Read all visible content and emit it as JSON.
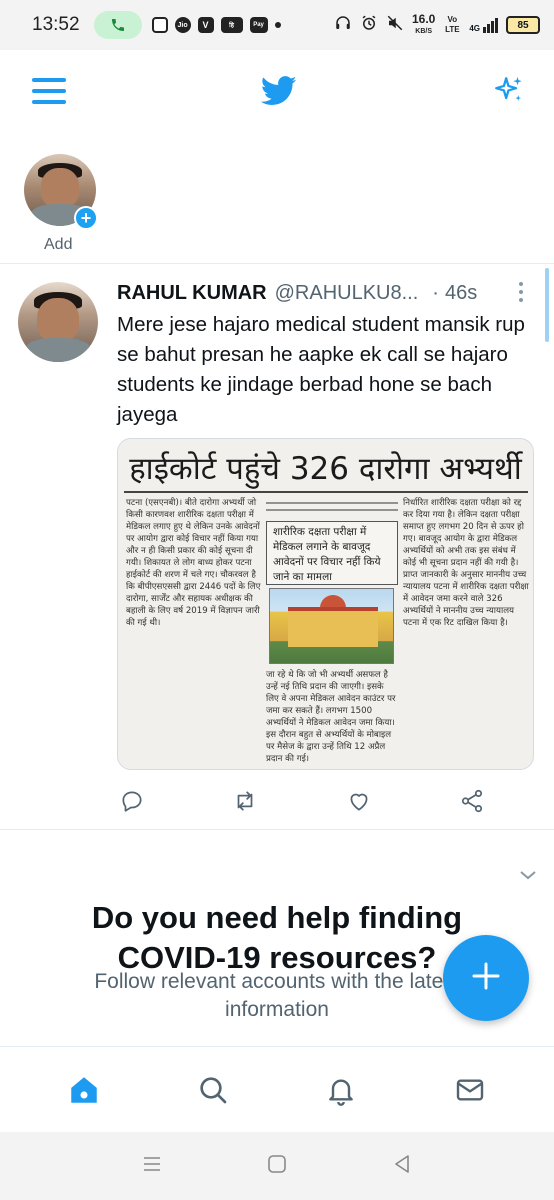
{
  "status_bar": {
    "time": "13:52",
    "net_speed_value": "16.0",
    "net_speed_unit": "KB/S",
    "volte": "Vo LTE",
    "network": "4G",
    "battery": "85"
  },
  "header": {
    "menu_icon": "menu-icon",
    "logo_icon": "twitter-bird-icon",
    "sparkle_icon": "sparkle-icon"
  },
  "fleets": {
    "add_label": "Add"
  },
  "tweet": {
    "name": "RAHUL KUMAR",
    "handle": "@RAHULKU8...",
    "separator": "·",
    "time": "46s",
    "text": "Mere jese hajaro medical student mansik rup se bahut presan he aapke ek call se hajaro students ke jindage berbad hone se bach jayega",
    "media": {
      "headline": "हाईकोर्ट पहुंचे 326 दारोगा अभ्यर्थी",
      "subhead": "शारीरिक दक्षता परीक्षा में मेडिकल लगाने के बावजूद आवेदनों पर विचार नहीं किये जाने का मामला",
      "col1": "पटना (एसएनबी)। बीते दारोगा अभ्यर्थी जो किसी कारणवश शारीरिक दक्षता परीक्षा में मेडिकल लगाए हुए थे लेकिन उनके आवेदनों पर आयोग द्वारा कोई विचार नहीं किया गया और न ही किसी प्रकार की कोई सूचना दी गयी। शिकायत ले लोग बाध्य होकर पटना हाईकोर्ट की शरण में चले गए। चौकरवल है कि बीपीएसएससी द्वारा 2446 पदों के लिए दारोगा, सार्जेंट और सहायक अधीक्षक की बहाली के लिए वर्ष 2019 में विज्ञापन जारी की गई थी।",
      "col2": "जा रहे थे कि जो भी अभ्यर्थी असफल है उन्हें नई तिथि प्रदान की जाएगी। इसके लिए वे अपना मेडिकल आवेदन काउंटर पर जमा कर सकते हैं। लगभग 1500 अभ्यर्थियों ने मेडिकल आवेदन जमा किया। इस दौरान बहुत से अभ्यर्थियों के मोबाइल पर मैसेज के द्वारा उन्हें तिथि 12 अप्रैल प्रदान की गई।",
      "col3": "निर्धारित शारीरिक दक्षता परीक्षा को रद्द कर दिया गया है। लेकिन दक्षता परीक्षा समाप्त हुए लगभग 20 दिन से ऊपर हो गए। बावजूद आयोग के द्वारा मेडिकल अभ्यर्थियों को अभी तक इस संबंध में कोई भी सूचना प्रदान नहीं की गयी है। प्राप्त जानकारी के अनुसार माननीय उच्च न्यायालय पटना में शारीरिक दक्षता परीक्षा में आवेदन जमा करने वाले 326 अभ्यर्थियों ने माननीय उच्च न्यायालय पटना में एक रिट दाखिल किया है।"
    },
    "actions": [
      "reply-icon",
      "retweet-icon",
      "like-icon",
      "share-icon"
    ]
  },
  "covid_prompt": {
    "title_line1": "Do you need help finding",
    "title_line2": "COVID-19 resources?",
    "subtitle_line1": "Follow relevant accounts with the latest",
    "subtitle_line2": "information"
  },
  "fab": {
    "icon": "compose-plus-icon"
  },
  "bottom_nav": [
    "home-icon",
    "search-icon",
    "notifications-icon",
    "messages-icon"
  ],
  "system_nav": [
    "recents-icon",
    "home-button-icon",
    "back-icon"
  ],
  "colors": {
    "accent": "#1d9bf0",
    "text": "#0f1419",
    "secondary": "#536471"
  }
}
